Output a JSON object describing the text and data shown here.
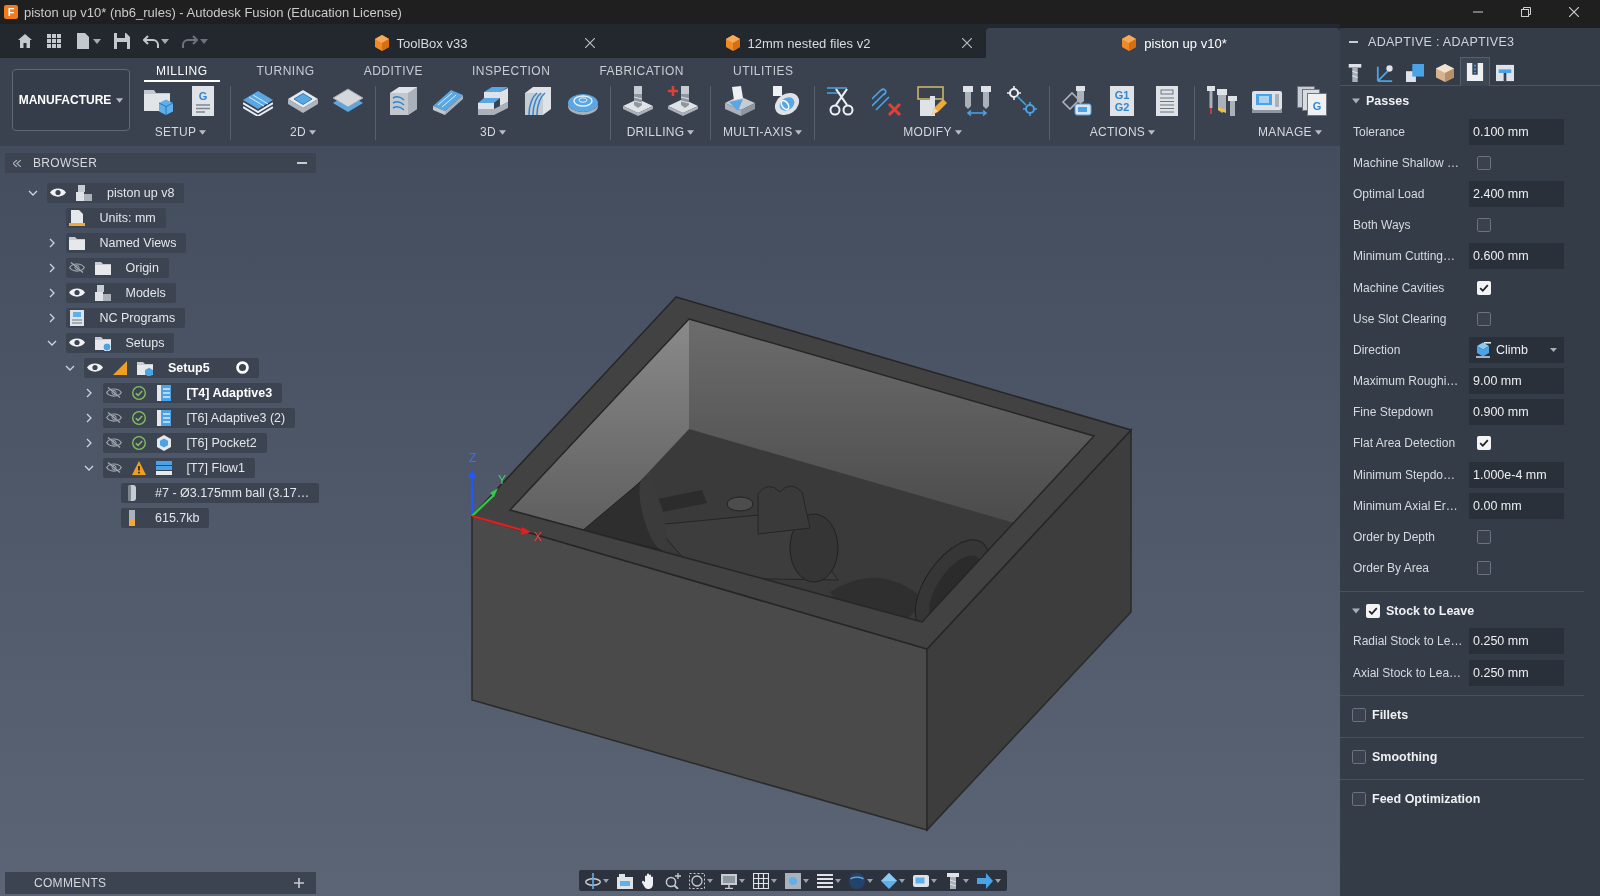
{
  "window": {
    "logo": "F",
    "title": "piston up v10* (nb6_rules) - Autodesk Fusion (Education License)"
  },
  "quick_access": [
    {
      "kind": "home",
      "dropdown": false,
      "disabled": false
    },
    {
      "kind": "apps",
      "dropdown": false,
      "disabled": false
    },
    {
      "kind": "file",
      "dropdown": true,
      "disabled": false
    },
    {
      "kind": "save",
      "dropdown": false,
      "disabled": false
    },
    {
      "kind": "undo",
      "dropdown": true,
      "disabled": false
    },
    {
      "kind": "redo",
      "dropdown": true,
      "disabled": true
    }
  ],
  "document_tabs": [
    {
      "title": "ToolBox v33",
      "selected": false
    },
    {
      "title": "12mm nested files v2",
      "selected": false
    },
    {
      "title": "piston up v10*",
      "selected": true
    }
  ],
  "workspace": {
    "label": "MANUFACTURE"
  },
  "ribbon_tabs": [
    {
      "label": "MILLING",
      "selected": true
    },
    {
      "label": "TURNING",
      "selected": false
    },
    {
      "label": "ADDITIVE",
      "selected": false
    },
    {
      "label": "INSPECTION",
      "selected": false
    },
    {
      "label": "FABRICATION",
      "selected": false
    },
    {
      "label": "UTILITIES",
      "selected": false
    }
  ],
  "ribbon_groups": [
    {
      "label": "SETUP",
      "tools": [
        {
          "kind": "setup"
        },
        {
          "kind": "nc-program",
          "glyph": [
            "G"
          ]
        }
      ]
    },
    {
      "label": "2D",
      "tools": [
        {
          "kind": "adaptive-2d"
        },
        {
          "kind": "pocket-2d"
        },
        {
          "kind": "face"
        }
      ]
    },
    {
      "label": "3D",
      "tools": [
        {
          "kind": "adaptive-3d"
        },
        {
          "kind": "pocket-3d"
        },
        {
          "kind": "steep"
        },
        {
          "kind": "flow"
        },
        {
          "kind": "radial"
        }
      ]
    },
    {
      "label": "DRILLING",
      "tools": [
        {
          "kind": "drill"
        },
        {
          "kind": "hole-recognition"
        }
      ]
    },
    {
      "label": "MULTI-AXIS",
      "tools": [
        {
          "kind": "swarf"
        },
        {
          "kind": "rotary"
        }
      ]
    },
    {
      "label": "MODIFY",
      "tools": [
        {
          "kind": "trim"
        },
        {
          "kind": "delete"
        },
        {
          "kind": "edit"
        },
        {
          "kind": "reorder"
        },
        {
          "kind": "link"
        }
      ]
    },
    {
      "label": "ACTIONS",
      "tools": [
        {
          "kind": "simulate"
        },
        {
          "kind": "post",
          "glyph": [
            "G1",
            "G2"
          ]
        },
        {
          "kind": "sheet"
        }
      ]
    },
    {
      "label": "MANAGE",
      "tools": [
        {
          "kind": "library"
        },
        {
          "kind": "machine"
        },
        {
          "kind": "templates",
          "glyph": [
            "G"
          ]
        }
      ]
    }
  ],
  "browser": {
    "title": "BROWSER",
    "tree": [
      {
        "label": "piston up v8",
        "kind": "component",
        "visible": true,
        "expandable": true,
        "expanded": true,
        "current": false,
        "active": false,
        "children": [
          {
            "label": "Units: mm",
            "kind": "units",
            "expandable": false,
            "current": false,
            "active": false
          },
          {
            "label": "Named Views",
            "kind": "folder",
            "expandable": true,
            "expanded": false,
            "current": false,
            "active": false
          },
          {
            "label": "Origin",
            "kind": "folder",
            "visible": false,
            "expandable": true,
            "expanded": false,
            "current": false,
            "active": false
          },
          {
            "label": "Models",
            "kind": "component",
            "visible": true,
            "expandable": true,
            "expanded": false,
            "current": false,
            "active": false
          },
          {
            "label": "NC Programs",
            "kind": "programs",
            "expandable": true,
            "expanded": false,
            "current": false,
            "active": false
          },
          {
            "label": "Setups",
            "kind": "setups",
            "visible": true,
            "expandable": true,
            "expanded": true,
            "current": false,
            "active": false,
            "children": [
              {
                "label": "Setup5",
                "kind": "setup",
                "visible": true,
                "expandable": true,
                "expanded": true,
                "current": true,
                "active": true,
                "children": [
                  {
                    "label": "[T4] Adaptive3",
                    "kind": "adaptive",
                    "visible": false,
                    "warning": false,
                    "expandable": true,
                    "expanded": false,
                    "current": true,
                    "active": false
                  },
                  {
                    "label": "[T6] Adaptive3 (2)",
                    "kind": "adaptive",
                    "visible": false,
                    "warning": false,
                    "expandable": true,
                    "expanded": false,
                    "current": false,
                    "active": false
                  },
                  {
                    "label": "[T6] Pocket2",
                    "kind": "pocket",
                    "visible": false,
                    "warning": false,
                    "expandable": true,
                    "expanded": false,
                    "current": false,
                    "active": false
                  },
                  {
                    "label": "[T7] Flow1",
                    "kind": "flow",
                    "visible": false,
                    "warning": true,
                    "expandable": true,
                    "expanded": true,
                    "current": false,
                    "active": false,
                    "children": [
                      {
                        "label": "#7 - Ø3.175mm ball (3.17…",
                        "kind": "tool",
                        "expandable": false,
                        "current": false,
                        "active": false
                      },
                      {
                        "label": "615.7kb",
                        "kind": "file",
                        "expandable": false,
                        "current": false,
                        "active": false
                      }
                    ]
                  }
                ]
              }
            ]
          }
        ]
      }
    ]
  },
  "comments": {
    "title": "COMMENTS"
  },
  "viewport": {
    "axes": [
      {
        "kind": "z",
        "label": "Z"
      },
      {
        "kind": "y",
        "label": "Y"
      },
      {
        "kind": "x",
        "label": "X"
      }
    ]
  },
  "operation_panel": {
    "title": "ADAPTIVE : ADAPTIVE3",
    "tabs": [
      {
        "kind": "tool",
        "selected": false
      },
      {
        "kind": "axes",
        "selected": false
      },
      {
        "kind": "geometry",
        "selected": false
      },
      {
        "kind": "heights",
        "selected": false
      },
      {
        "kind": "passes",
        "selected": true
      },
      {
        "kind": "linking",
        "selected": false
      }
    ],
    "sections": [
      {
        "kind": "group",
        "title": "Passes",
        "expanded": true,
        "rows": [
          {
            "kind": "value",
            "label": "Tolerance",
            "value": "0.100 mm"
          },
          {
            "kind": "check",
            "label": "Machine Shallow …",
            "checked": false
          },
          {
            "kind": "value",
            "label": "Optimal Load",
            "value": "2.400 mm"
          },
          {
            "kind": "check",
            "label": "Both Ways",
            "checked": false
          },
          {
            "kind": "value",
            "label": "Minimum Cutting…",
            "value": "0.600 mm"
          },
          {
            "kind": "check",
            "label": "Machine Cavities",
            "checked": true
          },
          {
            "kind": "check",
            "label": "Use Slot Clearing",
            "checked": false
          },
          {
            "kind": "select",
            "label": "Direction",
            "value": "Climb"
          },
          {
            "kind": "value",
            "label": "Maximum Roughi…",
            "value": "9.00 mm"
          },
          {
            "kind": "value",
            "label": "Fine Stepdown",
            "value": "0.900 mm"
          },
          {
            "kind": "check",
            "label": "Flat Area Detection",
            "checked": true
          },
          {
            "kind": "value",
            "label": "Minimum Stepdo…",
            "value": "1.000e-4 mm"
          },
          {
            "kind": "value",
            "label": "Minimum Axial Er…",
            "value": "0.00 mm"
          },
          {
            "kind": "check",
            "label": "Order by Depth",
            "checked": false
          },
          {
            "kind": "check",
            "label": "Order By Area",
            "checked": false
          }
        ]
      },
      {
        "kind": "toggle",
        "title": "Stock to Leave",
        "checked": true,
        "rows": [
          {
            "kind": "value",
            "label": "Radial Stock to Le…",
            "value": "0.250 mm"
          },
          {
            "kind": "value",
            "label": "Axial Stock to Lea…",
            "value": "0.250 mm"
          }
        ]
      },
      {
        "kind": "toggle",
        "title": "Fillets",
        "checked": false
      },
      {
        "kind": "toggle",
        "title": "Smoothing",
        "checked": false
      },
      {
        "kind": "toggle",
        "title": "Feed Optimization",
        "checked": false
      }
    ]
  }
}
